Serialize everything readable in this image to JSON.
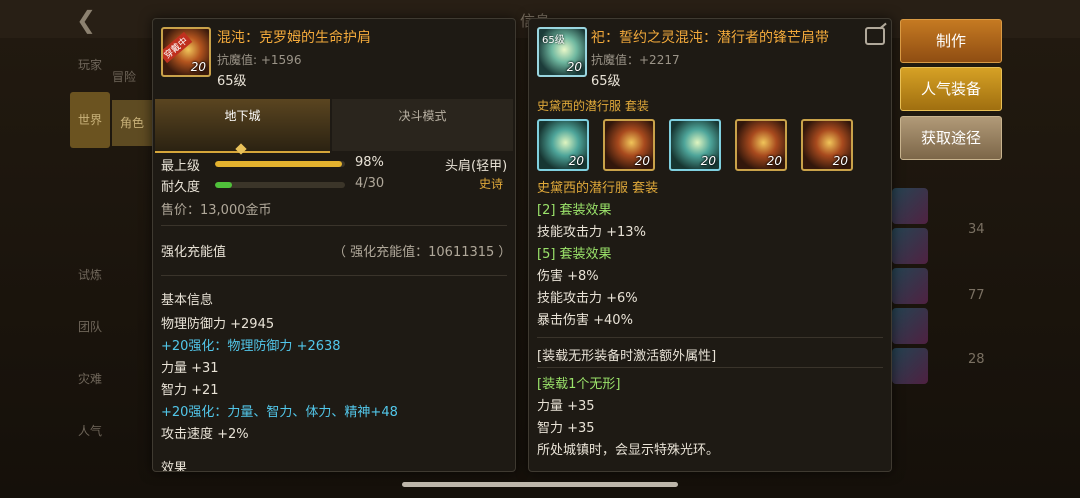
{
  "background": {
    "title": "信息",
    "left_items": [
      "玩家",
      "冒险",
      "试炼",
      "团队",
      "灾难",
      "人气"
    ],
    "tab_world": "世界",
    "tab_role": "角色",
    "side_numbers": [
      "34",
      "77",
      "28"
    ]
  },
  "left_item": {
    "name": "混沌：克罗姆的生命护肩",
    "magic_resist": "抗魔值: +1596",
    "level": "65级",
    "icon_num": "20",
    "icon_tag": "穿戴中",
    "tabs": [
      "地下城",
      "决斗模式"
    ],
    "grade_label": "最上级",
    "grade_value": "98%",
    "grade_fraction": 0.98,
    "durability_label": "耐久度",
    "durability_value": "4/30",
    "durability_fraction": 0.133,
    "slot_type": "头肩(轻甲)",
    "rarity": "史诗",
    "price": "售价：13,000金币",
    "enhance_title": "强化充能值",
    "enhance_value": "（ 强化充能值：10611315 ）",
    "basic_title": "基本信息",
    "stats": [
      {
        "text": "物理防御力 +2945",
        "color": "white"
      },
      {
        "text": "+20强化：物理防御力 +2638",
        "color": "cyan"
      },
      {
        "text": "力量 +31",
        "color": "white"
      },
      {
        "text": "智力 +21",
        "color": "white"
      },
      {
        "text": "+20强化：力量、智力、体力、精神+48",
        "color": "cyan"
      },
      {
        "text": "攻击速度 +2%",
        "color": "white"
      }
    ],
    "effect_title": "效果"
  },
  "right_item": {
    "name": "祀：誓约之灵混沌：潜行者的锋芒肩带",
    "magic_resist": "抗魔值：+2217",
    "level": "65级",
    "icon_lv": "65级",
    "icon_num": "20",
    "set_header": "史黛西的潜行服 套装",
    "set_slots": [
      {
        "num": "20",
        "style": "blue"
      },
      {
        "num": "20",
        "style": "gold"
      },
      {
        "num": "20",
        "style": "blue"
      },
      {
        "num": "20",
        "style": "gold"
      },
      {
        "num": "20",
        "style": "gold"
      }
    ],
    "set_name": "史黛西的潜行服 套装",
    "lines": [
      {
        "text": "[2] 套装效果",
        "color": "green"
      },
      {
        "text": "技能攻击力 +13%",
        "color": "white"
      },
      {
        "text": "[5] 套装效果",
        "color": "green"
      },
      {
        "text": "伤害 +8%",
        "color": "white"
      },
      {
        "text": "技能攻击力 +6%",
        "color": "white"
      },
      {
        "text": "暴击伤害 +40%",
        "color": "white"
      }
    ],
    "extra_title": "[装载无形装备时激活额外属性]",
    "extra_lines": [
      {
        "text": "[装载1个无形]",
        "color": "green"
      },
      {
        "text": "力量 +35",
        "color": "white"
      },
      {
        "text": "智力 +35",
        "color": "white"
      },
      {
        "text": "所处城镇时，会显示特殊光环。",
        "color": "white"
      }
    ]
  },
  "buttons": {
    "craft": "制作",
    "popular": "人气装备",
    "obtain": "获取途径"
  }
}
